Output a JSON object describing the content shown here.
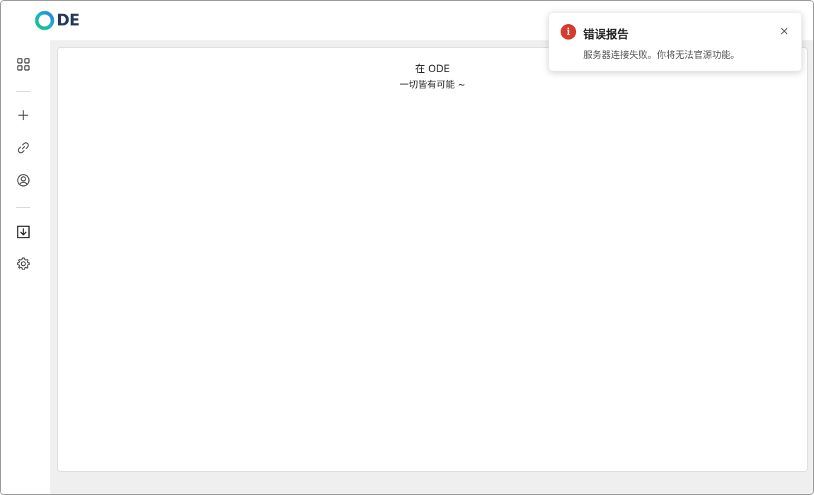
{
  "app": {
    "logo_text": "DE"
  },
  "sidebar": {
    "items": [
      {
        "icon": "grid-icon"
      },
      {
        "icon": "plus-icon"
      },
      {
        "icon": "link-icon"
      },
      {
        "icon": "user-circle-icon"
      },
      {
        "icon": "download-box-icon"
      },
      {
        "icon": "gear-icon"
      }
    ]
  },
  "main": {
    "title": "在 ODE",
    "subtitle": "一切皆有可能 ~"
  },
  "toast": {
    "title": "错误报告",
    "message": "服务器连接失败。你将无法官源功能。",
    "icon_label": "i",
    "close_label": "×",
    "accent_color": "#d63b2f"
  },
  "colors": {
    "brand_ring_start": "#14b8a6",
    "brand_ring_end": "#2f7de1",
    "brand_text": "#273a5c",
    "content_bg": "#efefef"
  }
}
